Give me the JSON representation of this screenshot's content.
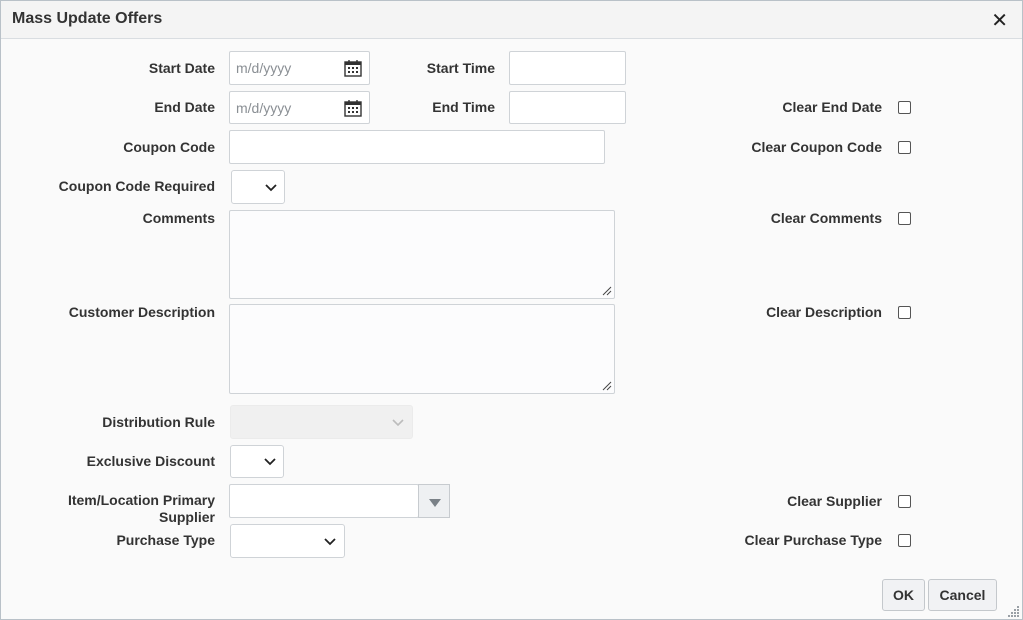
{
  "dialog": {
    "title": "Mass Update Offers",
    "close_icon": "close-icon (×)"
  },
  "fields": {
    "start_date": {
      "label": "Start Date",
      "placeholder": "m/d/yyyy"
    },
    "start_time": {
      "label": "Start Time",
      "value": ""
    },
    "end_date": {
      "label": "End Date",
      "placeholder": "m/d/yyyy"
    },
    "end_time": {
      "label": "End Time",
      "value": ""
    },
    "coupon_code": {
      "label": "Coupon Code",
      "value": ""
    },
    "coupon_code_required": {
      "label": "Coupon Code Required",
      "value": ""
    },
    "comments": {
      "label": "Comments",
      "value": ""
    },
    "customer_description": {
      "label": "Customer Description",
      "value": ""
    },
    "distribution_rule": {
      "label": "Distribution Rule",
      "value": ""
    },
    "exclusive_discount": {
      "label": "Exclusive Discount",
      "value": ""
    },
    "primary_supplier": {
      "label": "Item/Location Primary Supplier",
      "value": ""
    },
    "purchase_type": {
      "label": "Purchase Type",
      "value": ""
    }
  },
  "clear_options": [
    {
      "key": "end_date",
      "label": "Clear End Date",
      "checked": false
    },
    {
      "key": "coupon_code",
      "label": "Clear Coupon Code",
      "checked": false
    },
    {
      "key": "comments",
      "label": "Clear Comments",
      "checked": false
    },
    {
      "key": "description",
      "label": "Clear Description",
      "checked": false
    },
    {
      "key": "supplier",
      "label": "Clear Supplier",
      "checked": false
    },
    {
      "key": "purchase_type",
      "label": "Clear Purchase Type",
      "checked": false
    }
  ],
  "buttons": {
    "ok": "OK",
    "cancel": "Cancel"
  },
  "icons": [
    "close-icon",
    "calendar-icon",
    "chevron-down-icon",
    "dropdown-triangle-icon",
    "resize-grip-icon"
  ]
}
